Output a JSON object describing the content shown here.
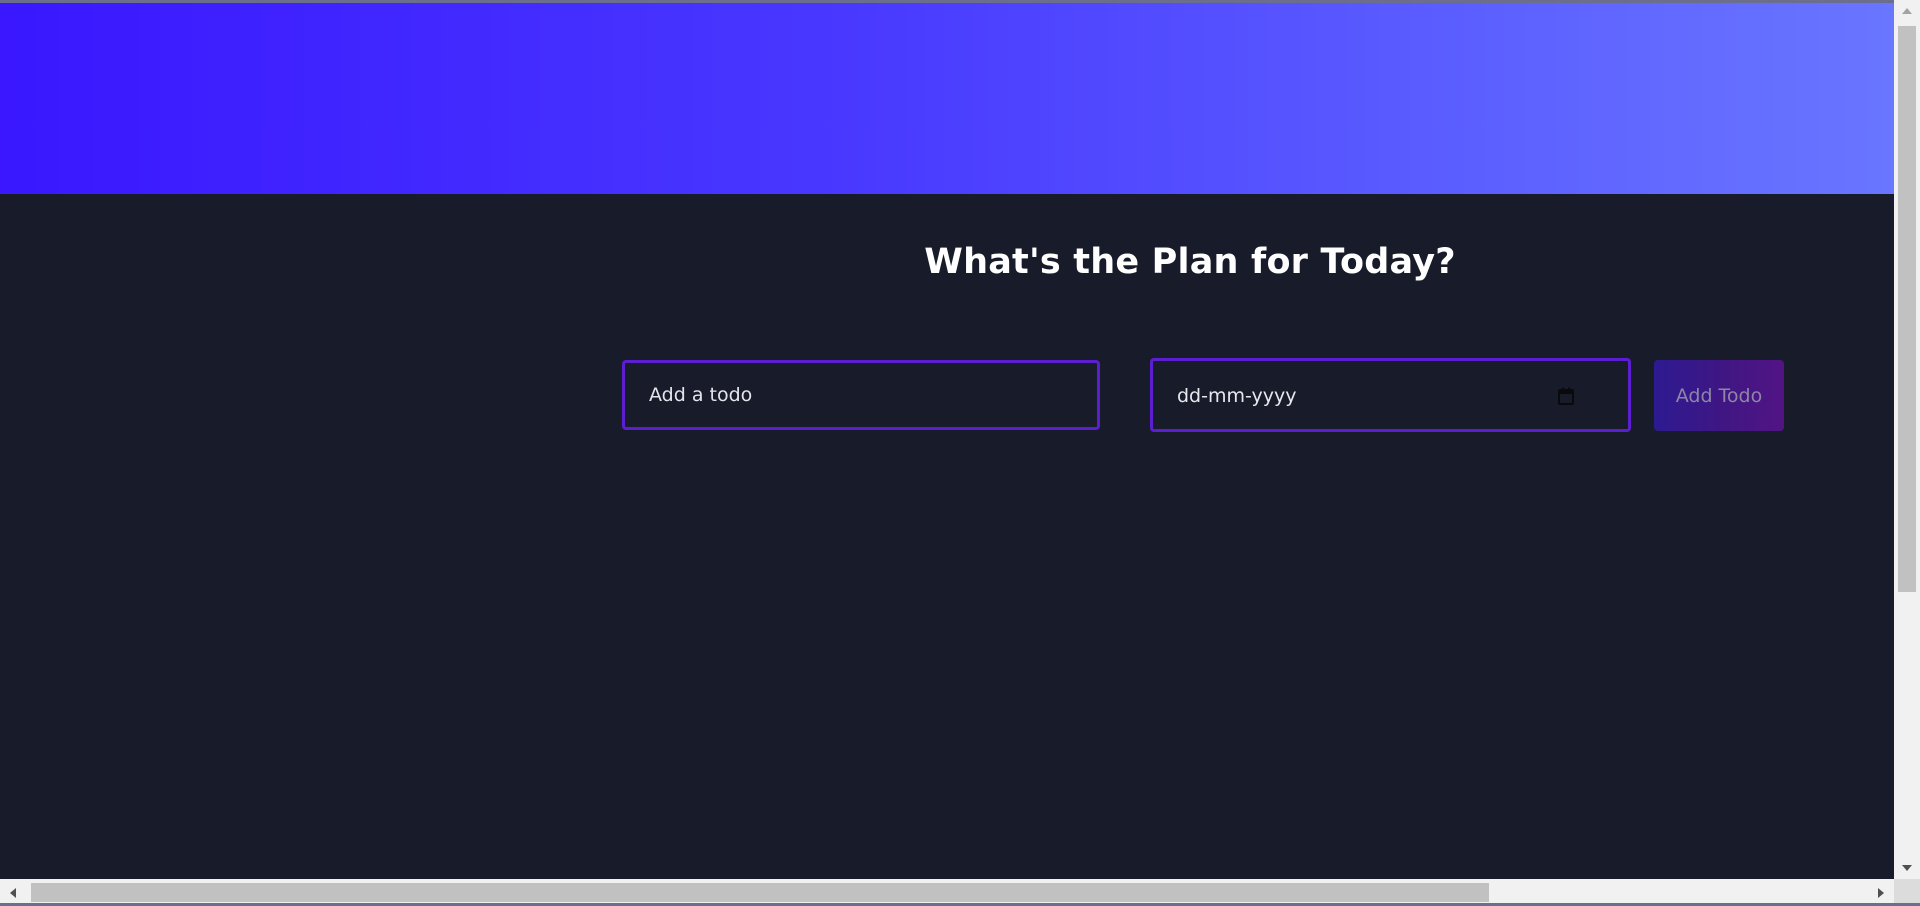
{
  "page": {
    "heading": "What's the Plan for Today?"
  },
  "form": {
    "todo_placeholder": "Add a todo",
    "date_placeholder": "dd-mm-yyyy",
    "submit_label": "Add Todo"
  },
  "colors": {
    "background": "#181b2a",
    "hero_gradient_start": "#3a17ff",
    "hero_gradient_end": "#6976ff",
    "input_border": "#5b1ed1",
    "button_gradient_start": "#2d1a91",
    "button_gradient_end": "#521485",
    "heading_text": "#ffffff"
  },
  "icons": {
    "date_picker": "calendar-icon",
    "scroll_up": "chevron-up-icon",
    "scroll_down": "chevron-down-icon",
    "scroll_left": "chevron-left-icon",
    "scroll_right": "chevron-right-icon"
  }
}
